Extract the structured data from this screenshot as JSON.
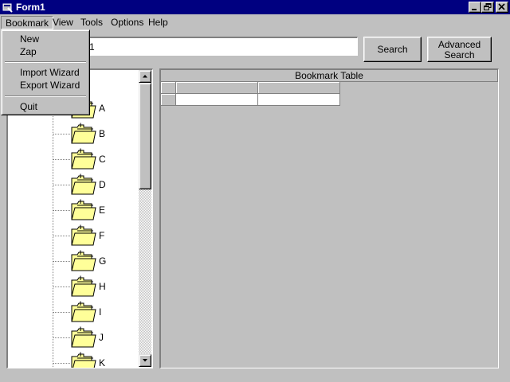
{
  "window": {
    "title": "Form1"
  },
  "menu": {
    "items": [
      {
        "label": "Bookmark"
      },
      {
        "label": "View"
      },
      {
        "label": "Tools"
      },
      {
        "label": "Options"
      },
      {
        "label": "Help"
      }
    ],
    "bookmark_dropdown": [
      {
        "label": "New"
      },
      {
        "label": "Zap"
      },
      {
        "label": "Import Wizard"
      },
      {
        "label": "Export Wizard"
      },
      {
        "label": "Quit"
      }
    ]
  },
  "search": {
    "value": "1",
    "button_label": "Search",
    "advanced_line1": "Advanced",
    "advanced_line2": "Search"
  },
  "tree": {
    "items": [
      {
        "label": "A"
      },
      {
        "label": "B"
      },
      {
        "label": "C"
      },
      {
        "label": "D"
      },
      {
        "label": "E"
      },
      {
        "label": "F"
      },
      {
        "label": "G"
      },
      {
        "label": "H"
      },
      {
        "label": "I"
      },
      {
        "label": "J"
      },
      {
        "label": "K"
      }
    ],
    "folder_icon": "folder-icon",
    "colors": {
      "folder_fill": "#ffff99",
      "folder_outline": "#000000"
    }
  },
  "table": {
    "caption": "Bookmark Table"
  },
  "colors": {
    "titlebar": "#000080",
    "face": "#c0c0c0"
  }
}
